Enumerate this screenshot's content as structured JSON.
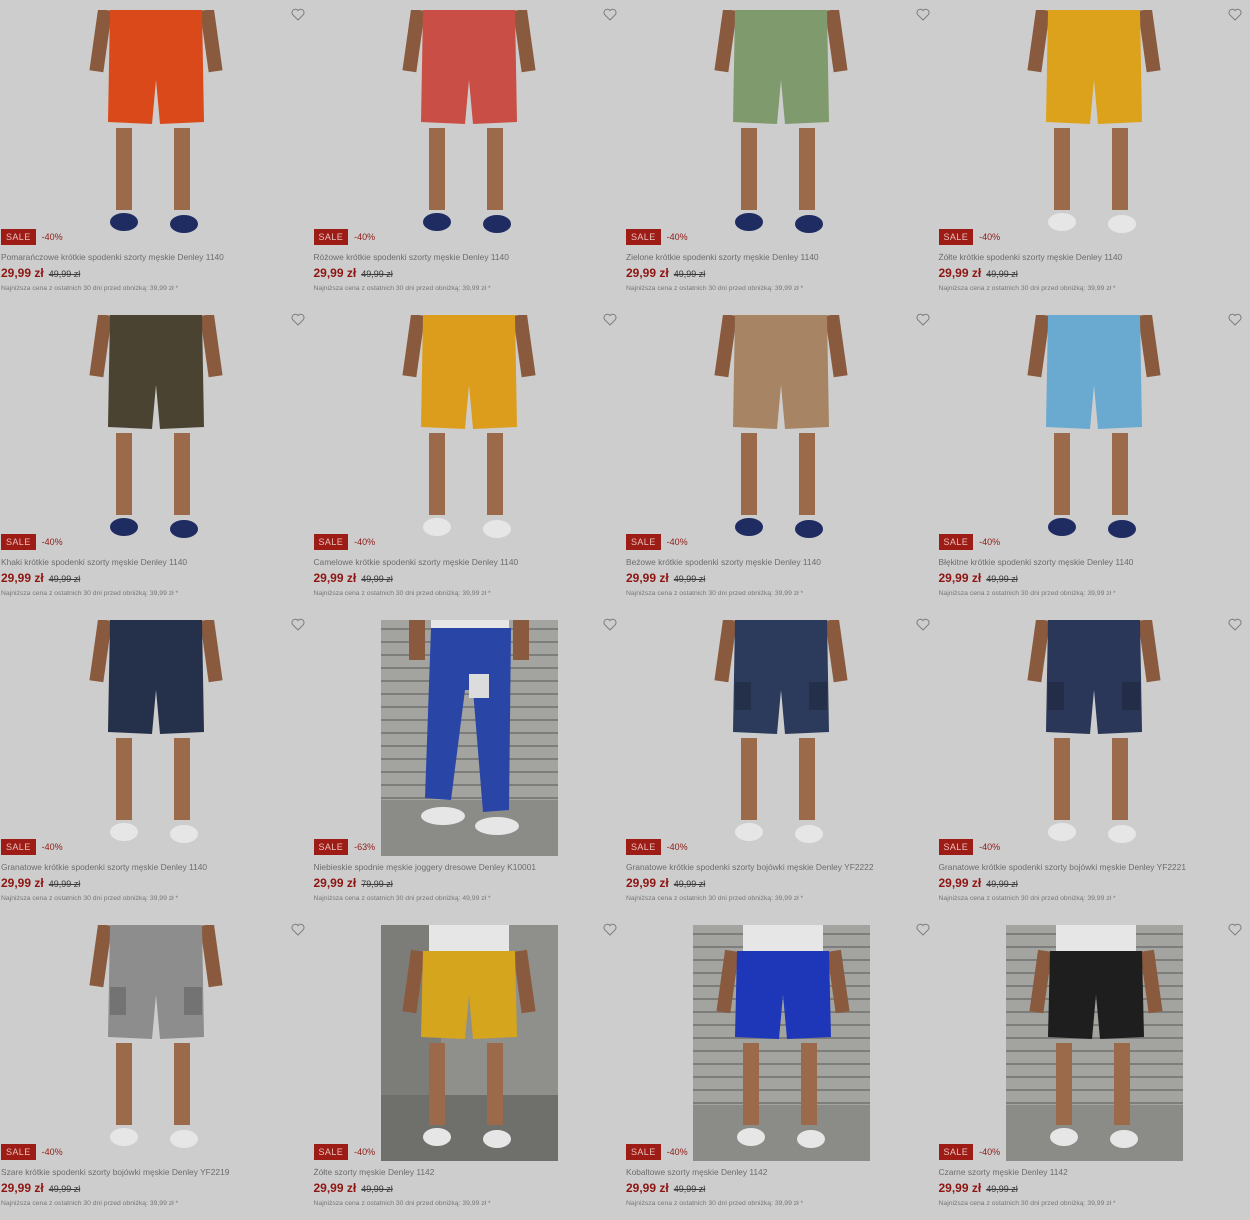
{
  "products": [
    {
      "name": "Pomarańczowe krótkie spodenki szorty męskie Denley 1140",
      "sale": "SALE",
      "discount": "-40%",
      "price": "29,99 zł",
      "old_price": "49,99 zł",
      "lowest": "Najniższa cena z ostatnich 30 dni przed obniżką: 39,99 zł *",
      "color": "#d9491a",
      "style": "studio",
      "shoes": "navy"
    },
    {
      "name": "Różowe krótkie spodenki szorty męskie Denley 1140",
      "sale": "SALE",
      "discount": "-40%",
      "price": "29,99 zł",
      "old_price": "49,99 zł",
      "lowest": "Najniższa cena z ostatnich 30 dni przed obniżką: 39,99 zł *",
      "color": "#c94f46",
      "style": "studio",
      "shoes": "navy"
    },
    {
      "name": "Zielone krótkie spodenki szorty męskie Denley 1140",
      "sale": "SALE",
      "discount": "-40%",
      "price": "29,99 zł",
      "old_price": "49,99 zł",
      "lowest": "Najniższa cena z ostatnich 30 dni przed obniżką: 39,99 zł *",
      "color": "#7f9a6c",
      "style": "studio",
      "shoes": "navy"
    },
    {
      "name": "Żółte krótkie spodenki szorty męskie Denley 1140",
      "sale": "SALE",
      "discount": "-40%",
      "price": "29,99 zł",
      "old_price": "49,99 zł",
      "lowest": "Najniższa cena z ostatnich 30 dni przed obniżką: 39,99 zł *",
      "color": "#dca21b",
      "style": "studio",
      "shoes": "white"
    },
    {
      "name": "Khaki krótkie spodenki szorty męskie Denley 1140",
      "sale": "SALE",
      "discount": "-40%",
      "price": "29,99 zł",
      "old_price": "49,99 zł",
      "lowest": "Najniższa cena z ostatnich 30 dni przed obniżką: 39,99 zł *",
      "color": "#4a4331",
      "style": "studio",
      "shoes": "navy"
    },
    {
      "name": "Camelowe krótkie spodenki szorty męskie Denley 1140",
      "sale": "SALE",
      "discount": "-40%",
      "price": "29,99 zł",
      "old_price": "49,99 zł",
      "lowest": "Najniższa cena z ostatnich 30 dni przed obniżką: 39,99 zł *",
      "color": "#dc9d1c",
      "style": "studio",
      "shoes": "white"
    },
    {
      "name": "Beżowe krótkie spodenki szorty męskie Denley 1140",
      "sale": "SALE",
      "discount": "-40%",
      "price": "29,99 zł",
      "old_price": "49,99 zł",
      "lowest": "Najniższa cena z ostatnich 30 dni przed obniżką: 39,99 zł *",
      "color": "#a68464",
      "style": "studio",
      "shoes": "navy"
    },
    {
      "name": "Błękitne krótkie spodenki szorty męskie Denley 1140",
      "sale": "SALE",
      "discount": "-40%",
      "price": "29,99 zł",
      "old_price": "49,99 zł",
      "lowest": "Najniższa cena z ostatnich 30 dni przed obniżką: 39,99 zł *",
      "color": "#6aa9d0",
      "style": "studio",
      "shoes": "navy"
    },
    {
      "name": "Granatowe krótkie spodenki szorty męskie Denley 1140",
      "sale": "SALE",
      "discount": "-40%",
      "price": "29,99 zł",
      "old_price": "49,99 zł",
      "lowest": "Najniższa cena z ostatnich 30 dni przed obniżką: 39,99 zł *",
      "color": "#25304a",
      "style": "studio-step",
      "shoes": "white"
    },
    {
      "name": "Niebieskie spodnie męskie joggery dresowe Denley K10001",
      "sale": "SALE",
      "discount": "-63%",
      "price": "29,99 zł",
      "old_price": "79,99 zł",
      "lowest": "Najniższa cena z ostatnich 30 dni przed obniżką: 49,99 zł *",
      "color": "#2945a6",
      "style": "stairs-jogger",
      "shoes": "white"
    },
    {
      "name": "Granatowe krótkie spodenki szorty bojówki męskie Denley YF2222",
      "sale": "SALE",
      "discount": "-40%",
      "price": "29,99 zł",
      "old_price": "49,99 zł",
      "lowest": "Najniższa cena z ostatnich 30 dni przed obniżką: 39,99 zł *",
      "color": "#2c3a5b",
      "style": "studio-step",
      "shoes": "white"
    },
    {
      "name": "Granatowe krótkie spodenki szorty bojówki męskie Denley YF2221",
      "sale": "SALE",
      "discount": "-40%",
      "price": "29,99 zł",
      "old_price": "49,99 zł",
      "lowest": "Najniższa cena z ostatnich 30 dni przed obniżką: 39,99 zł *",
      "color": "#2b3758",
      "style": "studio-step",
      "shoes": "white"
    },
    {
      "name": "Szare krótkie spodenki szorty bojówki męskie Denley YF2219",
      "sale": "SALE",
      "discount": "-40%",
      "price": "29,99 zł",
      "old_price": "49,99 zł",
      "lowest": "Najniższa cena z ostatnich 30 dni przed obniżką: 39,99 zł *",
      "color": "#8d8d8d",
      "style": "studio-step",
      "shoes": "white"
    },
    {
      "name": "Żółte szorty męskie Denley 1142",
      "sale": "SALE",
      "discount": "-40%",
      "price": "29,99 zł",
      "old_price": "49,99 zł",
      "lowest": "Najniższa cena z ostatnich 30 dni przed obniżką: 39,99 zł *",
      "color": "#d5a61d",
      "style": "concrete",
      "shoes": "white"
    },
    {
      "name": "Kobaltowe szorty męskie Denley 1142",
      "sale": "SALE",
      "discount": "-40%",
      "price": "29,99 zł",
      "old_price": "49,99 zł",
      "lowest": "Najniższa cena z ostatnich 30 dni przed obniżką: 39,99 zł *",
      "color": "#1d37b8",
      "style": "stairs",
      "shoes": "white"
    },
    {
      "name": "Czarne szorty męskie Denley 1142",
      "sale": "SALE",
      "discount": "-40%",
      "price": "29,99 zł",
      "old_price": "49,99 zł",
      "lowest": "Najniższa cena z ostatnich 30 dni przed obniżką: 39,99 zł *",
      "color": "#1e1e1e",
      "style": "stairs",
      "shoes": "white"
    }
  ]
}
